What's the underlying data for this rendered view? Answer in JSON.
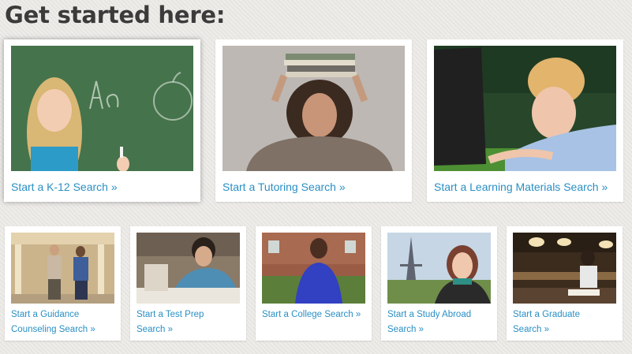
{
  "heading": "Get started here:",
  "cards": [
    {
      "label": "Start a K-12 Search »",
      "image": "girl-at-chalkboard-photo"
    },
    {
      "label": "Start a Tutoring Search »",
      "image": "girl-balancing-books-photo"
    },
    {
      "label": "Start a Learning Materials Search »",
      "image": "woman-with-laptop-photo"
    },
    {
      "line1": "Start a Guidance",
      "line2": "Counseling Search »",
      "image": "students-walking-photo"
    },
    {
      "line1": "Start a Test Prep",
      "line2": "Search »",
      "image": "student-writing-exam-photo"
    },
    {
      "line1": "Start a College Search »",
      "line2": "",
      "image": "college-student-campus-photo"
    },
    {
      "line1": "Start a Study Abroad",
      "line2": "Search »",
      "image": "student-eiffel-tower-photo"
    },
    {
      "line1": "Start a Graduate",
      "line2": "Search »",
      "image": "library-study-photo"
    }
  ]
}
